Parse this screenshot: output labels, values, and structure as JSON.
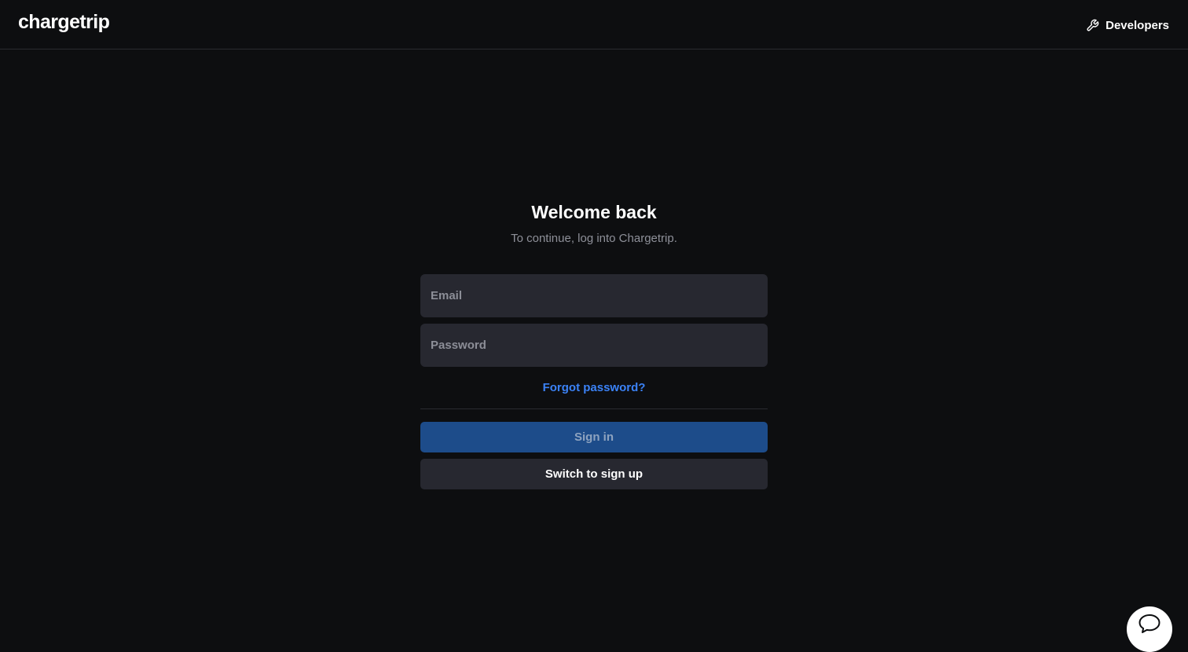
{
  "header": {
    "logo_text": "chargetrip",
    "developers_label": "Developers",
    "developers_icon": "wrench-icon"
  },
  "login": {
    "title": "Welcome back",
    "subtitle": "To continue, log into Chargetrip.",
    "email_placeholder": "Email",
    "password_placeholder": "Password",
    "forgot_label": "Forgot password?",
    "sign_in_label": "Sign in",
    "switch_label": "Switch to sign up"
  },
  "chat": {
    "icon": "chat-bubble-icon"
  },
  "colors": {
    "background": "#0d0e10",
    "input_background": "#272830",
    "link_blue": "#3b82f6",
    "primary_button": "#1d4c8a"
  }
}
